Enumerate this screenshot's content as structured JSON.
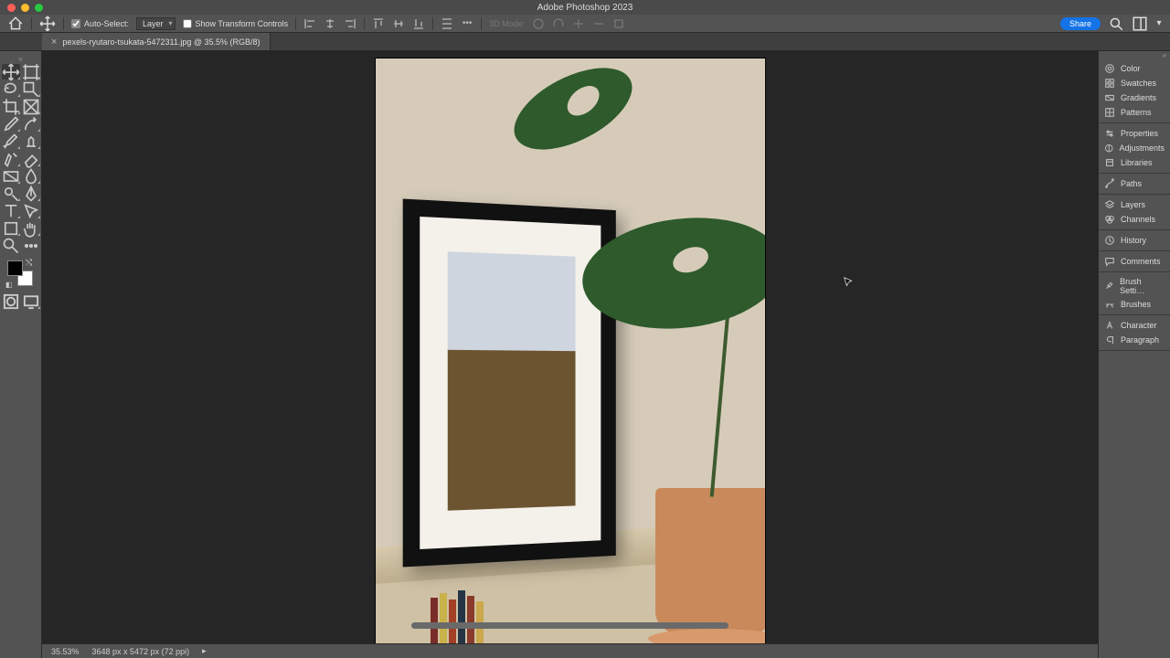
{
  "app": {
    "title": "Adobe Photoshop 2023"
  },
  "tab": {
    "filename": "pexels-ryutaro-tsukata-5472311.jpg @ 35.5% (RGB/8)"
  },
  "options": {
    "auto_select_label": "Auto-Select:",
    "layer_mode": "Layer",
    "transform_label": "Show Transform Controls",
    "mode_3d": "3D Mode:",
    "share": "Share"
  },
  "status": {
    "zoom": "35.53%",
    "doc": "3648 px x 5472 px (72 ppi)"
  },
  "panels": {
    "g1": [
      "Color",
      "Swatches",
      "Gradients",
      "Patterns"
    ],
    "g2": [
      "Properties",
      "Adjustments",
      "Libraries"
    ],
    "g3": [
      "Paths"
    ],
    "g4": [
      "Layers",
      "Channels"
    ],
    "g5": [
      "History"
    ],
    "g6": [
      "Comments"
    ],
    "g7": [
      "Brush Setti…",
      "Brushes"
    ],
    "g8": [
      "Character",
      "Paragraph"
    ]
  },
  "tools": {
    "list": [
      "move-tool",
      "artboard-tool",
      "lasso-tool",
      "quick-select-tool",
      "crop-tool",
      "frame-tool",
      "eyedropper-tool",
      "spot-heal-tool",
      "brush-tool",
      "clone-stamp-tool",
      "history-brush-tool",
      "eraser-tool",
      "gradient-tool",
      "blur-tool",
      "dodge-tool",
      "pen-tool",
      "type-tool",
      "path-select-tool",
      "rectangle-tool",
      "hand-tool",
      "zoom-tool",
      "edit-toolbar"
    ]
  },
  "colors": {
    "accent": "#1473e6"
  }
}
